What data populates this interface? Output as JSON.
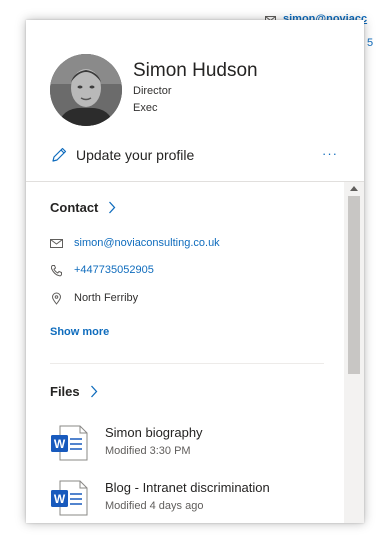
{
  "background": {
    "email_fragment": "simon@noviacc",
    "fragment_two": "5"
  },
  "profile": {
    "name": "Simon Hudson",
    "title": "Director",
    "department": "Exec",
    "update_label": "Update your profile",
    "more_label": "···"
  },
  "contact": {
    "heading": "Contact",
    "email": "simon@noviaconsulting.co.uk",
    "phone": "+447735052905",
    "location": "North Ferriby",
    "show_more": "Show more"
  },
  "files": {
    "heading": "Files",
    "items": [
      {
        "name": "Simon biography",
        "modified": "Modified 3:30 PM",
        "icon": "word-doc-icon"
      },
      {
        "name": "Blog - Intranet discrimination",
        "modified": "Modified 4 days ago",
        "icon": "word-doc-icon"
      }
    ]
  },
  "colors": {
    "link": "#0f6cbd",
    "word": "#185abd",
    "divider": "#e1dfdd",
    "scroll_track": "#f3f2f1",
    "scroll_thumb": "#c8c6c4"
  }
}
